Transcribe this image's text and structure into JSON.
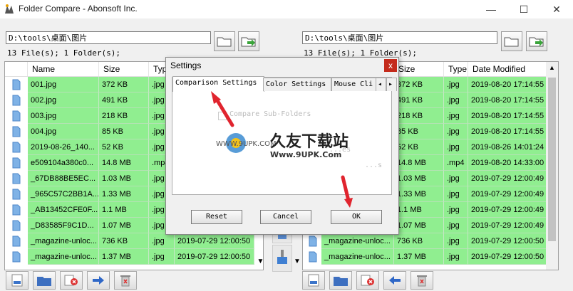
{
  "window": {
    "title": "Folder Compare - Abonsoft Inc.",
    "min_glyph": "—",
    "max_glyph": "☐",
    "close_glyph": "✕"
  },
  "left": {
    "path": "D:\\tools\\桌面\\图片",
    "count": "13 File(s); 1 Folder(s);",
    "columns": [
      "Name",
      "Size",
      "Type"
    ],
    "rows": [
      {
        "name": "001.jpg",
        "size": "372 KB",
        "type": ".jpg",
        "date": ""
      },
      {
        "name": "002.jpg",
        "size": "491 KB",
        "type": ".jpg",
        "date": ""
      },
      {
        "name": "003.jpg",
        "size": "218 KB",
        "type": ".jpg",
        "date": ""
      },
      {
        "name": "004.jpg",
        "size": "85 KB",
        "type": ".jpg",
        "date": ""
      },
      {
        "name": "2019-08-26_140...",
        "size": "52 KB",
        "type": ".jpg",
        "date": ""
      },
      {
        "name": "e509104a380c0...",
        "size": "14.8 MB",
        "type": ".mp4",
        "date": ""
      },
      {
        "name": "_67DB88BE5EC...",
        "size": "1.03 MB",
        "type": ".jpg",
        "date": ""
      },
      {
        "name": "_965C57C2BB1A...",
        "size": "1.33 MB",
        "type": ".jpg",
        "date": ""
      },
      {
        "name": "_AB13452CFE0F...",
        "size": "1.1 MB",
        "type": ".jpg",
        "date": ""
      },
      {
        "name": "_D83585F9C1D...",
        "size": "1.07 MB",
        "type": ".jpg",
        "date": ""
      },
      {
        "name": "_magazine-unloc...",
        "size": "736 KB",
        "type": ".jpg",
        "date": "2019-07-29 12:00:50"
      },
      {
        "name": "_magazine-unloc...",
        "size": "1.37 MB",
        "type": ".jpg",
        "date": "2019-07-29 12:00:50"
      }
    ]
  },
  "right": {
    "path": "D:\\tools\\桌面\\图片",
    "count": "13 File(s); 1 Folder(s);",
    "columns": [
      "Size",
      "Type",
      "Date Modified"
    ],
    "rows": [
      {
        "name": "",
        "size": "372 KB",
        "type": ".jpg",
        "date": "2019-08-20 17:14:55"
      },
      {
        "name": "",
        "size": "491 KB",
        "type": ".jpg",
        "date": "2019-08-20 17:14:55"
      },
      {
        "name": "",
        "size": "218 KB",
        "type": ".jpg",
        "date": "2019-08-20 17:14:55"
      },
      {
        "name": "",
        "size": "85 KB",
        "type": ".jpg",
        "date": "2019-08-20 17:14:55"
      },
      {
        "name": "",
        "size": "52 KB",
        "type": ".jpg",
        "date": "2019-08-26 14:01:24"
      },
      {
        "name": "",
        "size": "14.8 MB",
        "type": ".mp4",
        "date": "2019-08-20 14:33:00"
      },
      {
        "name": "",
        "size": "1.03 MB",
        "type": ".jpg",
        "date": "2019-07-29 12:00:49"
      },
      {
        "name": "",
        "size": "1.33 MB",
        "type": ".jpg",
        "date": "2019-07-29 12:00:49"
      },
      {
        "name": "",
        "size": "1.1 MB",
        "type": ".jpg",
        "date": "2019-07-29 12:00:49"
      },
      {
        "name": "",
        "size": "1.07 MB",
        "type": ".jpg",
        "date": "2019-07-29 12:00:49"
      },
      {
        "name": "_magazine-unloc...",
        "size": "736 KB",
        "type": ".jpg",
        "date": "2019-07-29 12:00:50"
      },
      {
        "name": "_magazine-unloc...",
        "size": "1.37 MB",
        "type": ".jpg",
        "date": "2019-07-29 12:00:50"
      }
    ]
  },
  "settings": {
    "title": "Settings",
    "close": "x",
    "tabs": [
      "Comparison Settings",
      "Color Settings",
      "Mouse Cli"
    ],
    "tab_scroll_left": "◂",
    "tab_scroll_right": "▸",
    "option_1": "Compare Sub-Folders",
    "option_2": "...es",
    "option_3": "...s",
    "reset": "Reset",
    "cancel": "Cancel",
    "ok": "OK"
  },
  "watermark": {
    "left": "WWW.9UPK.COM",
    "big": "久友下载站",
    "url": "Www.9UPK.Com"
  },
  "colors": {
    "row_match": "#90ee90",
    "arrow": "#e0242e",
    "dialog_close": "#c42b1c"
  }
}
